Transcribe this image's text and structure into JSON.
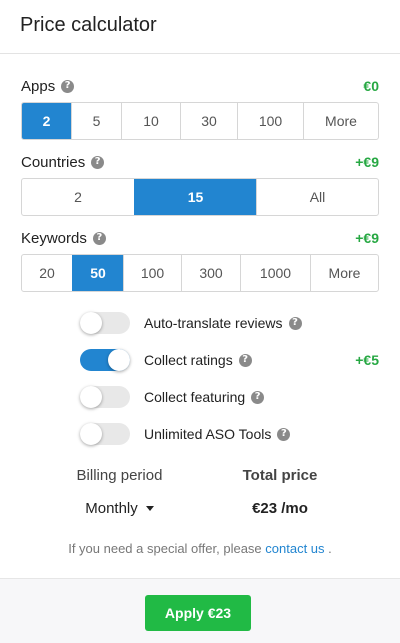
{
  "header": {
    "title": "Price calculator"
  },
  "apps": {
    "label": "Apps",
    "price": "€0",
    "options": [
      "2",
      "5",
      "10",
      "30",
      "100",
      "More"
    ],
    "selected": "2"
  },
  "countries": {
    "label": "Countries",
    "price": "+€9",
    "options": [
      "2",
      "15",
      "All"
    ],
    "selected": "15"
  },
  "keywords": {
    "label": "Keywords",
    "price": "+€9",
    "options": [
      "20",
      "50",
      "100",
      "300",
      "1000",
      "More"
    ],
    "selected": "50"
  },
  "toggles": [
    {
      "label": "Auto-translate reviews",
      "on": false,
      "price": ""
    },
    {
      "label": "Collect ratings",
      "on": true,
      "price": "+€5"
    },
    {
      "label": "Collect featuring",
      "on": false,
      "price": ""
    },
    {
      "label": "Unlimited ASO Tools",
      "on": false,
      "price": ""
    }
  ],
  "billing": {
    "period_title": "Billing period",
    "period_value": "Monthly",
    "total_title": "Total price",
    "total_value": "€23 /mo"
  },
  "note": {
    "text": "If you need a special offer, please",
    "link": "contact us",
    "end": "."
  },
  "footer": {
    "apply_label": "Apply €23"
  },
  "colors": {
    "accent_blue": "#2285d0",
    "green": "#21ba45",
    "price_green": "#27a843"
  },
  "icons": {
    "help": "question-circle-icon",
    "dropdown": "caret-down-icon"
  }
}
